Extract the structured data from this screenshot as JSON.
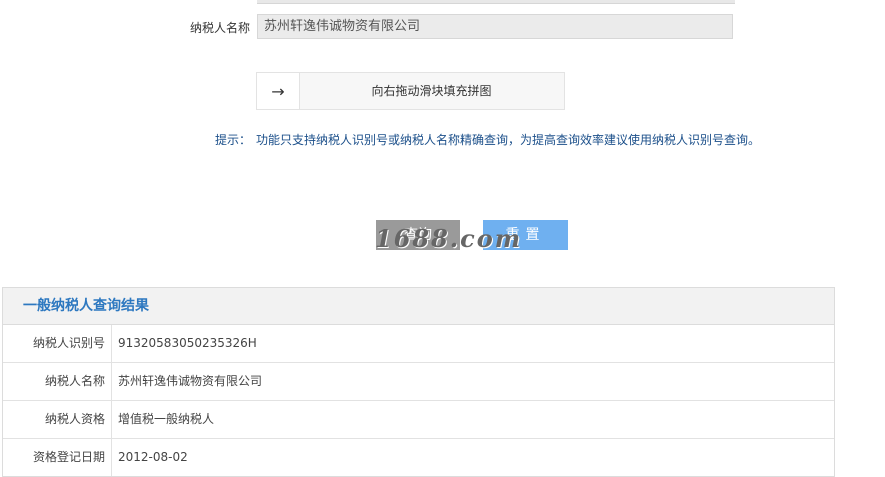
{
  "form": {
    "taxpayer_name_label": "纳税人名称",
    "taxpayer_name_value": "苏州轩逸伟诚物资有限公司",
    "slider": {
      "handle_icon": "arrow-right-icon",
      "handle_glyph": "→",
      "text": "向右拖动滑块填充拼图"
    },
    "hint_label": "提示：",
    "hint_text": "功能只支持纳税人识别号或纳税人名称精确查询，为提高查询效率建议使用纳税人识别号查询。",
    "query_button": "查询",
    "reset_button": "重置",
    "watermark": "1688.com"
  },
  "result": {
    "title": "一般纳税人查询结果",
    "rows": [
      {
        "label": "纳税人识别号",
        "value": "91320583050235326H"
      },
      {
        "label": "纳税人名称",
        "value": "苏州轩逸伟诚物资有限公司"
      },
      {
        "label": "纳税人资格",
        "value": "增值税一般纳税人"
      },
      {
        "label": "资格登记日期",
        "value": "2012-08-02"
      }
    ]
  },
  "colors": {
    "accent": "#2d78c0",
    "hint": "#1b4f8a",
    "reset_button": "#6fb0f0",
    "query_button": "#9a9a9a"
  }
}
